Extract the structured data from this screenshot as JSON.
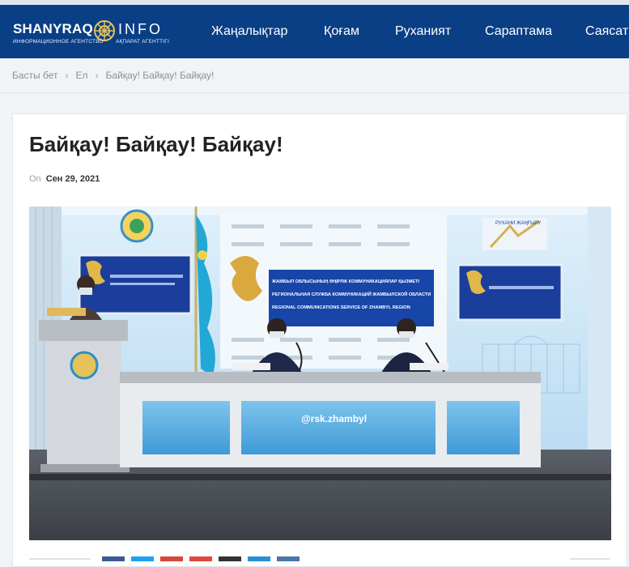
{
  "site": {
    "brand_left": "SHANYRAQ",
    "brand_right": "INFO",
    "brand_sub_left": "ИНФОРМАЦИОННОЕ АГЕНТСТВО",
    "brand_sub_right": "АҚПАРАТ АГЕНТТІГІ"
  },
  "nav": {
    "items": [
      "Жаңалықтар",
      "Қоғам",
      "Руханият",
      "Сараптама",
      "Саясат"
    ]
  },
  "breadcrumb": {
    "items": [
      "Басты бет",
      "Ел",
      "Байқау! Байқау! Байқау!"
    ]
  },
  "article": {
    "title": "Байқау! Байқау! Байқау!",
    "meta_prefix": "On",
    "date": "Сен 29, 2021"
  },
  "photo": {
    "banner_line1": "ЖАМБЫЛ ОБЛЫСЫНЫҢ ӨҢІРЛІК КОММУНИКАЦИЯЛАР ҚЫЗМЕТІ",
    "banner_line2": "РЕГИОНАЛЬНАЯ СЛУЖБА КОММУНИКАЦИЙ ЖАМБЫЛСКОЙ ОБЛАСТИ",
    "banner_line3": "REGIONAL COMMUNICATIONS SERVICE OF ZHAMBYL REGION",
    "desk_handle": "@rsk.zhambyl",
    "screen_caption": "РУХАНИ ЖАҢҒЫРУ"
  },
  "colors": {
    "nav_bg": "#0a3f86",
    "page_bg": "#f1f3f6",
    "card_bg": "#ffffff",
    "title_text": "#222222"
  }
}
